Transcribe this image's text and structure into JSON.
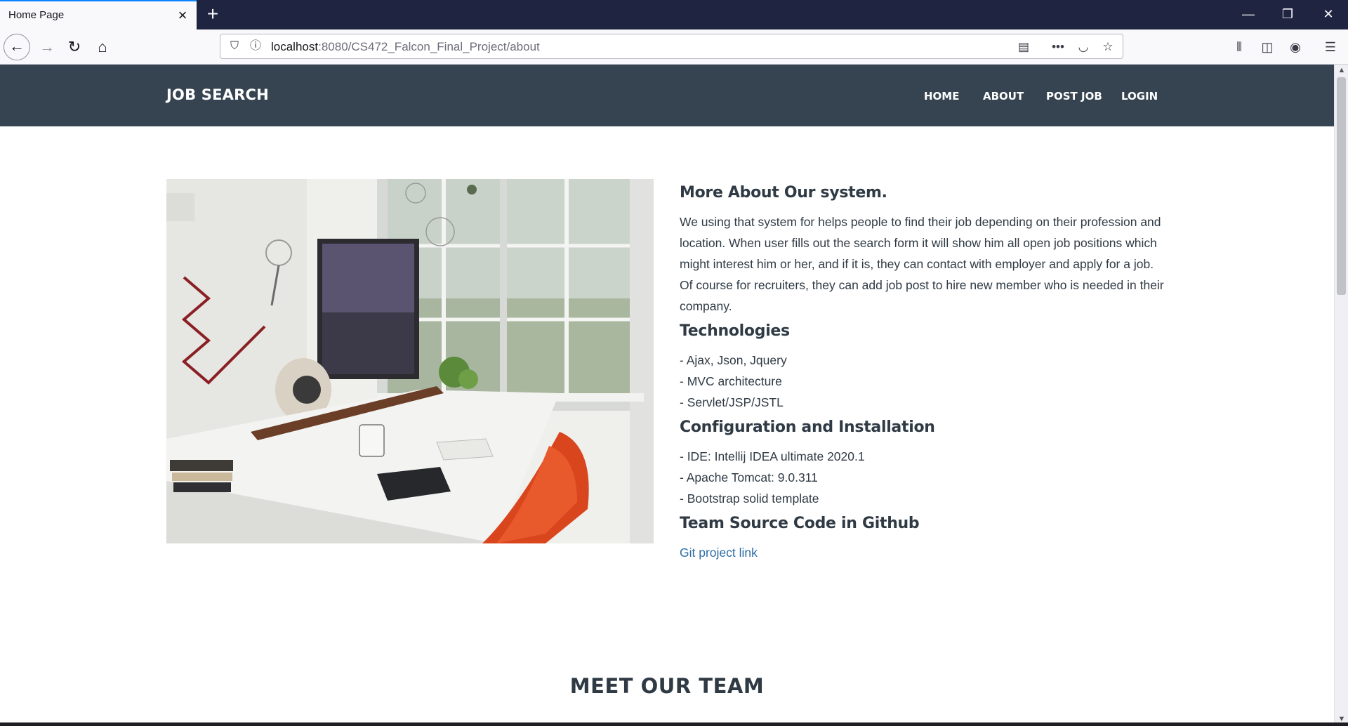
{
  "browser": {
    "tab_title": "Home Page",
    "new_tab_symbol": "+",
    "url_host": "localhost",
    "url_rest": ":8080/CS472_Falcon_Final_Project/about"
  },
  "site": {
    "brand": "JOB SEARCH",
    "menu": [
      "HOME",
      "ABOUT",
      "POST JOB",
      "LOGIN"
    ]
  },
  "about": {
    "title": "More About Our system.",
    "description": "We using that system for helps people to find their job depending on their profession and location. When user fills out the search form it will show him all open job positions which might interest him or her, and if it is, they can contact with employer and apply for a job. Of course for recruiters, they can add job post to hire new member who is needed in their company.",
    "tech_title": "Technologies",
    "tech_items": [
      "- Ajax, Json, Jquery",
      "- MVC architecture",
      "- Servlet/JSP/JSTL"
    ],
    "config_title": "Configuration and Installation",
    "config_items": [
      "- IDE: Intellij IDEA ultimate 2020.1",
      "- Apache Tomcat: 9.0.311",
      "- Bootstrap solid template"
    ],
    "source_title": "Team Source Code in Github",
    "source_link": "Git project link"
  },
  "team": {
    "title": "MEET OUR TEAM"
  },
  "colors": {
    "header_bg": "#364451",
    "link": "#2d6da3",
    "text": "#2f3a44"
  }
}
